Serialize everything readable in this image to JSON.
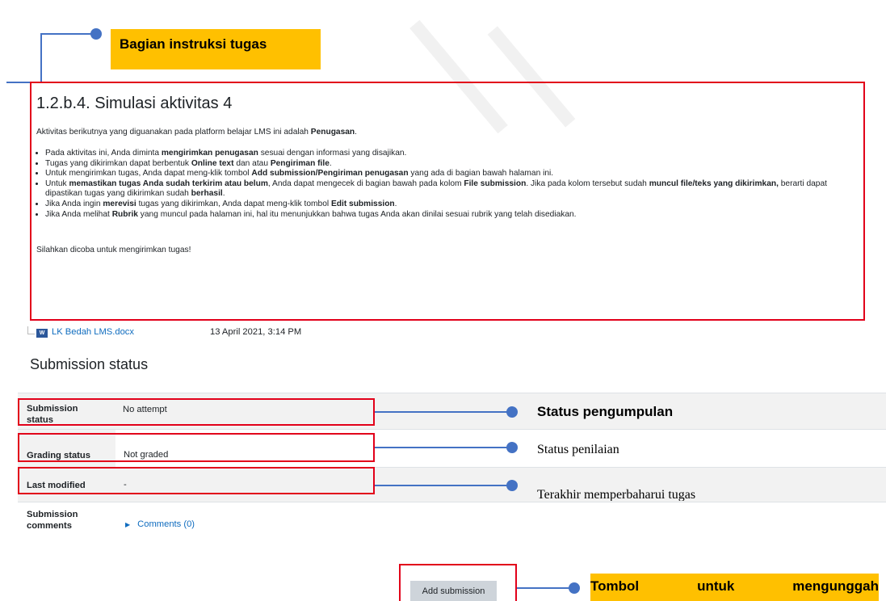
{
  "callouts": {
    "instructions": "Bagian instruksi tugas",
    "submission_status": "Status pengumpulan",
    "grading_status": "Status penilaian",
    "last_modified": "Terakhir memperbaharui tugas",
    "button": "Tombol untuk mengunggah"
  },
  "instructions": {
    "title": "1.2.b.4. Simulasi aktivitas 4",
    "intro_pre": "Aktivitas berikutnya yang diguanakan pada platform belajar LMS ini adalah ",
    "intro_bold": "Penugasan",
    "intro_post": ".",
    "bullets": [
      {
        "a": "Pada aktivitas ini, Anda diminta ",
        "b": "mengirimkan penugasan",
        "c": " sesuai dengan informasi yang disajikan."
      },
      {
        "a": "Tugas yang dikirimkan dapat berbentuk ",
        "b": "Online text",
        "c": " dan atau ",
        "d": "Pengiriman file",
        "e": "."
      },
      {
        "a": "Untuk mengirimkan tugas, Anda dapat meng-klik tombol ",
        "b": "Add submission/Pengiriman penugasan",
        "c": " yang ada di bagian bawah halaman ini."
      },
      {
        "a": "Untuk ",
        "b": "memastikan tugas Anda sudah terkirim atau belum",
        "c": ", Anda dapat mengecek di bagian bawah pada kolom ",
        "d": "File submission",
        "e": ". Jika pada kolom tersebut sudah ",
        "f": "muncul file/teks yang dikirimkan,",
        "g": " berarti dapat dipastikan tugas yang dikirimkan sudah ",
        "h": "berhasil",
        "i": "."
      },
      {
        "a": "Jika Anda ingin ",
        "b": "merevisi",
        "c": " tugas yang dikirimkan, Anda dapat meng-klik tombol ",
        "d": "Edit submission",
        "e": "."
      },
      {
        "a": "Jika Anda melihat ",
        "b": "Rubrik",
        "c": " yang muncul pada halaman ini, hal itu menunjukkan bahwa tugas Anda akan dinilai sesuai rubrik yang telah disediakan."
      }
    ],
    "closing": "Silahkan dicoba untuk mengirimkan tugas!"
  },
  "file": {
    "name": "LK Bedah LMS.docx",
    "date": "13 April 2021, 3:14 PM",
    "icon": "word-file-icon"
  },
  "status": {
    "heading": "Submission status",
    "rows": [
      {
        "label": "Submission status",
        "value": "No attempt"
      },
      {
        "label": "Grading status",
        "value": "Not graded"
      },
      {
        "label": "Last modified",
        "value": "-"
      },
      {
        "label": "Submission comments",
        "value": "Comments (0)"
      }
    ]
  },
  "button": {
    "label": "Add submission"
  },
  "colors": {
    "callout": "#4472c4",
    "highlight": "#ffc000",
    "frame": "#e2001a",
    "link": "#0f6cbf"
  }
}
